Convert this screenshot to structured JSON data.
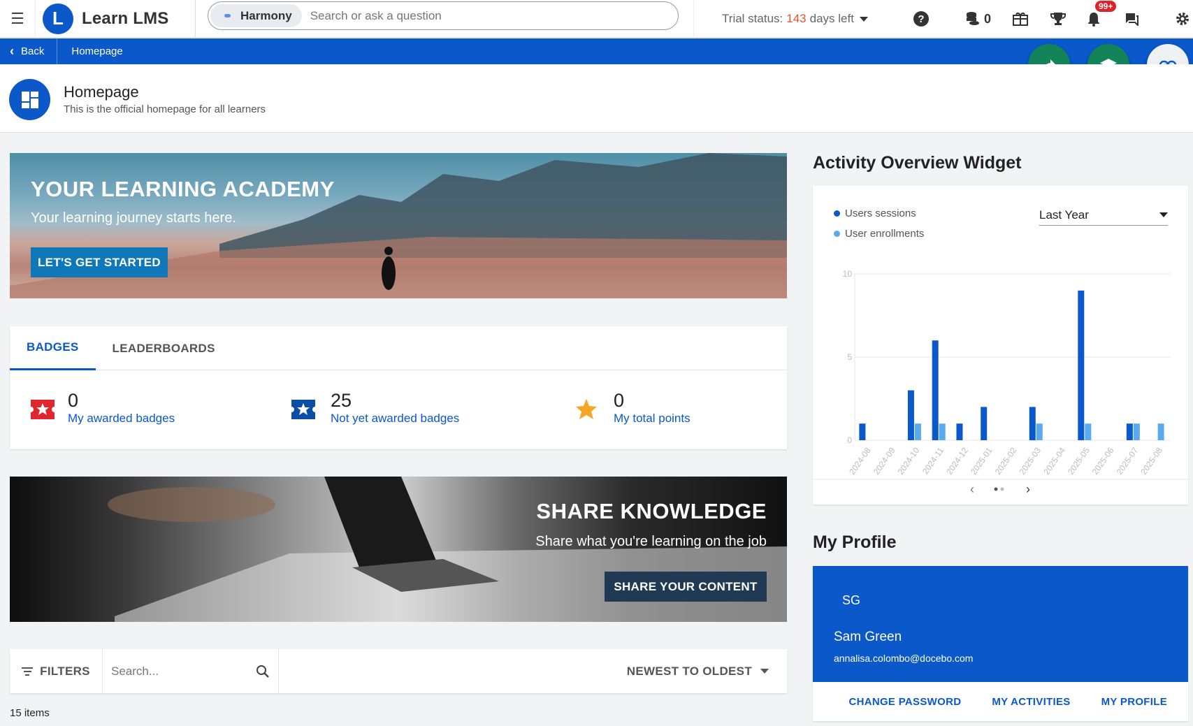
{
  "topbar": {
    "brand_name": "Learn LMS",
    "brand_logo_letter": "L",
    "search_chip": "Harmony",
    "search_placeholder": "Search or ask a question",
    "trial_label": "Trial status:",
    "trial_days": "143",
    "trial_suffix": "days left",
    "coins_count": "0",
    "notifications_badge": "99+",
    "icons": [
      "menu-icon",
      "help-icon",
      "coins-icon",
      "gift-icon",
      "trophy-icon",
      "bell-icon",
      "chat-icon",
      "gear-icon"
    ]
  },
  "navbar": {
    "back_label": "Back",
    "breadcrumb": "Homepage"
  },
  "page": {
    "title": "Homepage",
    "subtitle": "This is the official homepage for all learners"
  },
  "hero": {
    "title": "YOUR LEARNING ACADEMY",
    "subtitle": "Your learning journey starts here.",
    "button": "LET'S GET STARTED"
  },
  "badges": {
    "tabs": [
      {
        "label": "BADGES"
      },
      {
        "label": "LEADERBOARDS"
      }
    ],
    "stats": [
      {
        "value": "0",
        "label": "My awarded badges"
      },
      {
        "value": "25",
        "label": "Not yet awarded badges"
      },
      {
        "value": "0",
        "label": "My total points"
      }
    ]
  },
  "share": {
    "title": "SHARE KNOWLEDGE",
    "subtitle": "Share what you're learning on the job",
    "button": "SHARE YOUR CONTENT"
  },
  "filterbar": {
    "filters_label": "FILTERS",
    "search_placeholder": "Search...",
    "sort_label": "NEWEST TO OLDEST",
    "items_count": "15 items"
  },
  "widget": {
    "title": "Activity Overview Widget",
    "period": "Last Year",
    "colors": {
      "sessions": "#0a58ca",
      "enrollments": "#5aaaf0"
    }
  },
  "chart_data": {
    "type": "bar",
    "categories": [
      "2024-08",
      "2024-09",
      "2024-10",
      "2024-11",
      "2024-12",
      "2025-01",
      "2025-02",
      "2025-03",
      "2025-04",
      "2025-05",
      "2025-06",
      "2025-07",
      "2025-08"
    ],
    "series": [
      {
        "name": "Users sessions",
        "values": [
          1,
          0,
          3,
          6,
          1,
          2,
          0,
          2,
          0,
          9,
          0,
          1,
          0
        ]
      },
      {
        "name": "User enrollments",
        "values": [
          0,
          0,
          1,
          1,
          0,
          0,
          0,
          1,
          0,
          1,
          0,
          1,
          1
        ]
      }
    ],
    "yticks": [
      0,
      5,
      10
    ],
    "ylim": [
      0,
      10
    ],
    "grid": true,
    "legend": "top-left"
  },
  "profile": {
    "title": "My Profile",
    "initials": "SG",
    "name": "Sam Green",
    "email": "annalisa.colombo@docebo.com",
    "links": [
      {
        "label": "CHANGE PASSWORD"
      },
      {
        "label": "MY ACTIVITIES"
      },
      {
        "label": "MY PROFILE"
      }
    ]
  }
}
